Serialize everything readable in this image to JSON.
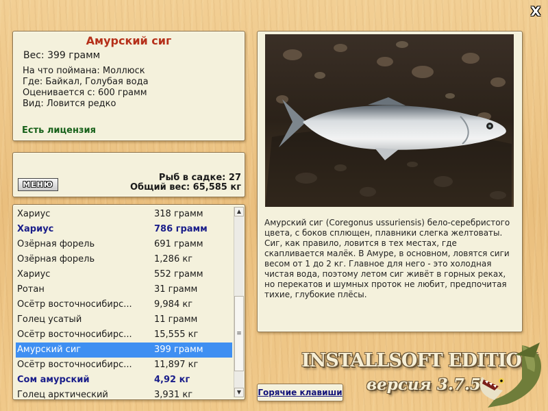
{
  "window": {
    "close_glyph": "X"
  },
  "info": {
    "title": "Амурский сиг",
    "weight": "Вес: 399 грамм",
    "bait": "На что поймана: Моллюск",
    "place": "Где: Байкал, Голубая вода",
    "value": "Оценивается с: 600 грамм",
    "kind": "Вид: Ловится редко",
    "license": "Есть лицензия"
  },
  "stats": {
    "menu_label": "МЕНЮ",
    "count": "Рыб в садке: 27",
    "total": "Общий вес: 65,585 кг"
  },
  "catch_list": [
    {
      "name": "Хариус",
      "weight": "318 грамм",
      "bold": false,
      "selected": false
    },
    {
      "name": "Хариус",
      "weight": "786 грамм",
      "bold": true,
      "selected": false
    },
    {
      "name": "Озёрная форель",
      "weight": "691 грамм",
      "bold": false,
      "selected": false
    },
    {
      "name": "Озёрная форель",
      "weight": "1,286 кг",
      "bold": false,
      "selected": false
    },
    {
      "name": "Хариус",
      "weight": "552 грамм",
      "bold": false,
      "selected": false
    },
    {
      "name": "Ротан",
      "weight": "31 грамм",
      "bold": false,
      "selected": false
    },
    {
      "name": "Осётр восточносибирс...",
      "weight": "9,984 кг",
      "bold": false,
      "selected": false
    },
    {
      "name": "Голец усатый",
      "weight": "11 грамм",
      "bold": false,
      "selected": false
    },
    {
      "name": "Осётр восточносибирс...",
      "weight": "15,555 кг",
      "bold": false,
      "selected": false
    },
    {
      "name": "Амурский сиг",
      "weight": "399 грамм",
      "bold": false,
      "selected": true
    },
    {
      "name": "Осётр восточносибирс...",
      "weight": "11,897 кг",
      "bold": false,
      "selected": false
    },
    {
      "name": "Сом амурский",
      "weight": "4,92 кг",
      "bold": true,
      "selected": false
    },
    {
      "name": "Голец арктический",
      "weight": "3,931 кг",
      "bold": false,
      "selected": false
    }
  ],
  "description": "Амурский сиг (Coregonus ussuriensis) бело-серебристого цвета, с боков сплющен, плавники слегка желтоваты. Сиг, как правило, ловится в тех местах, где скапливается малёк. В Амуре, в основном, ловятся сиги весом от 1 до 2 кг. Главное для него - это холодная чистая вода, поэтому летом сиг живёт в горных реках, но перекатов и шумных проток не любит, предпочитая тихие, глубокие плёсы.",
  "hotkeys_label": "Горячие клавиши",
  "brand": {
    "title": "INSTALLSOFT EDITION",
    "version": "версия 3.7.5"
  },
  "icons": {
    "scroll_up": "up-arrow-icon",
    "scroll_down": "down-arrow-icon",
    "logo": "pike-fish-icon"
  },
  "colors": {
    "title_red": "#b5301a",
    "license_green": "#17611a",
    "bold_blue": "#1a1e8a",
    "selection": "#3f8ff2"
  }
}
